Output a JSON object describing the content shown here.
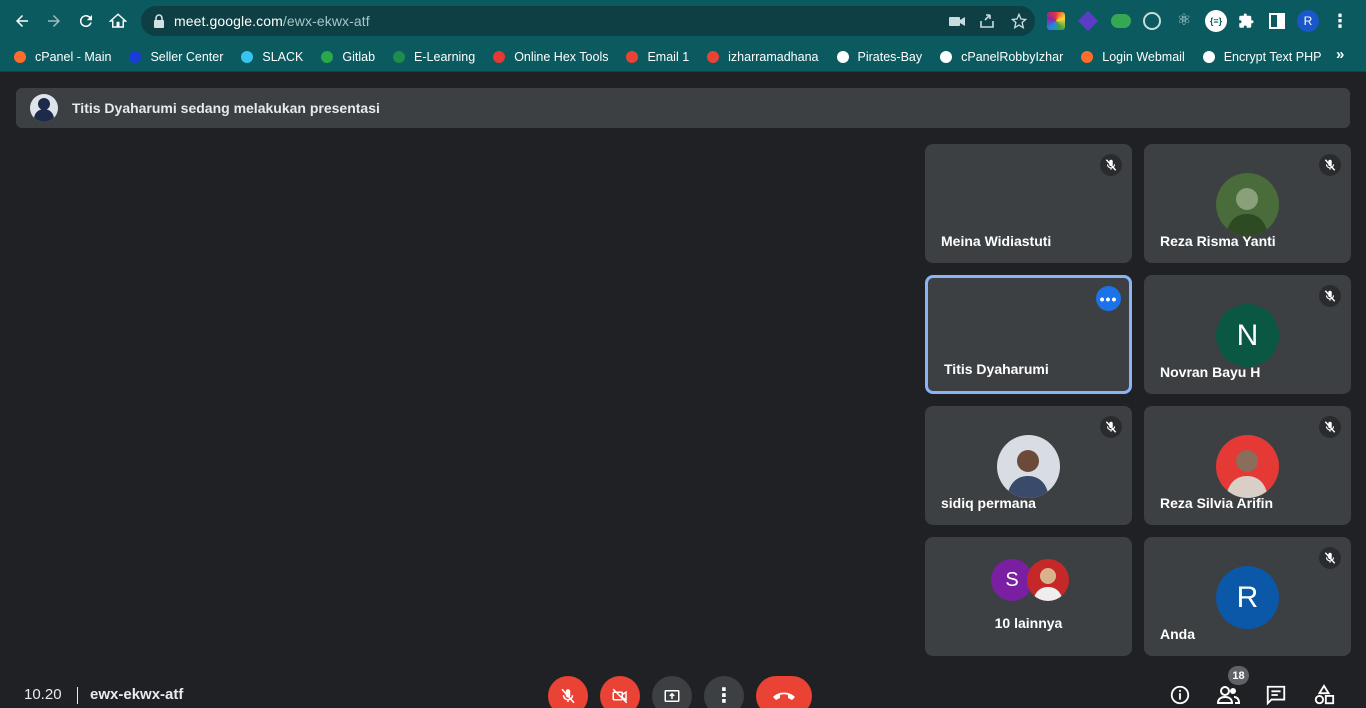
{
  "browser": {
    "url_host": "meet.google.com",
    "url_path": "/ewx-ekwx-atf",
    "profile_initial": "R"
  },
  "bookmarks": [
    {
      "label": "cPanel - Main",
      "icon": "cpanel-icon",
      "color": "#ff6c2c"
    },
    {
      "label": "Seller Center",
      "icon": "seller-icon",
      "color": "#1a3dd8"
    },
    {
      "label": "SLACK",
      "icon": "slack-icon",
      "color": "#36c5f0"
    },
    {
      "label": "Gitlab",
      "icon": "gitlab-icon",
      "color": "#2aa84a"
    },
    {
      "label": "E-Learning",
      "icon": "elearning-icon",
      "color": "#1e8c4a"
    },
    {
      "label": "Online Hex Tools",
      "icon": "hex-tools-icon",
      "color": "#e53935"
    },
    {
      "label": "Email 1",
      "icon": "gmail-icon",
      "color": "#ea4335"
    },
    {
      "label": "izharramadhana",
      "icon": "gmail-icon",
      "color": "#ea4335"
    },
    {
      "label": "Pirates-Bay",
      "icon": "pirate-icon",
      "color": "#ffffff"
    },
    {
      "label": "cPanelRobbyIzhar",
      "icon": "cpanel-robby-icon",
      "color": "#ffffff"
    },
    {
      "label": "Login Webmail",
      "icon": "cpanel-icon",
      "color": "#ff6c2c"
    },
    {
      "label": "Encrypt Text PHP",
      "icon": "globe-icon",
      "color": "#ffffff"
    }
  ],
  "meet": {
    "banner_text": "Titis Dyaharumi sedang melakukan presentasi",
    "tiles": [
      {
        "name": "Meina Widiastuti",
        "muted": true,
        "avatar": "none"
      },
      {
        "name": "Reza Risma Yanti",
        "muted": true,
        "avatar": "photo"
      },
      {
        "name": "Titis Dyaharumi",
        "muted": false,
        "avatar": "none",
        "active": true
      },
      {
        "name": "Novran Bayu H",
        "muted": true,
        "avatar": "letter",
        "letter": "N",
        "color": "#0b5746"
      },
      {
        "name": "sidiq permana",
        "muted": true,
        "avatar": "photo"
      },
      {
        "name": "Reza Silvia Arifin",
        "muted": true,
        "avatar": "photo"
      },
      {
        "name": "10 lainnya",
        "muted": false,
        "avatar": "group",
        "letter": "S",
        "color": "#7b1fa2"
      },
      {
        "name": "Anda",
        "muted": true,
        "avatar": "letter",
        "letter": "R",
        "color": "#0b57a8"
      }
    ],
    "time": "10.20",
    "meeting_code": "ewx-ekwx-atf",
    "participant_count": "18"
  }
}
